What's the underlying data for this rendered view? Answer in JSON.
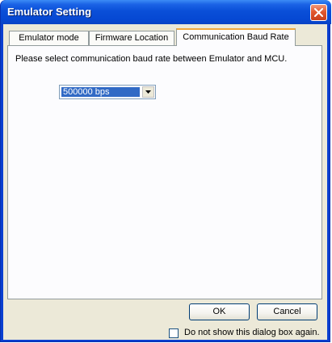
{
  "window": {
    "title": "Emulator Setting"
  },
  "tabs": [
    {
      "label": "Emulator mode",
      "active": false
    },
    {
      "label": "Firmware Location",
      "active": false
    },
    {
      "label": "Communication Baud Rate",
      "active": true
    }
  ],
  "panel": {
    "instruction": "Please select communication baud rate between Emulator and MCU.",
    "baud_rate_select": {
      "selected": "500000 bps"
    }
  },
  "buttons": {
    "ok_label": "OK",
    "cancel_label": "Cancel"
  },
  "footer": {
    "checkbox_label": "Do not show this dialog box again.",
    "checkbox_checked": false
  },
  "icons": {
    "close": "close-icon",
    "dropdown": "chevron-down-icon"
  },
  "colors": {
    "titlebar": "#0a4fd8",
    "close_button": "#e2582f",
    "selection": "#316ac5",
    "active_tab_highlight": "#f2a83b",
    "dialog_background": "#ece9d8"
  }
}
